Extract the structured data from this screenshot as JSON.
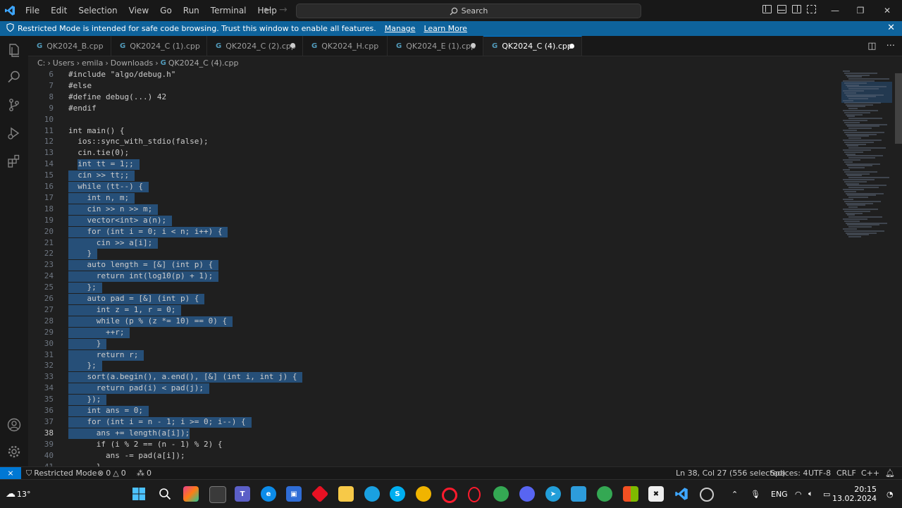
{
  "titlebar": {
    "menu": [
      "File",
      "Edit",
      "Selection",
      "View",
      "Go",
      "Run",
      "Terminal",
      "Help"
    ],
    "search_placeholder": "Search"
  },
  "banner": {
    "text": "Restricted Mode is intended for safe code browsing. Trust this window to enable all features.",
    "manage": "Manage",
    "learn_more": "Learn More"
  },
  "tabs": [
    {
      "label": "QK2024_B.cpp",
      "dirty": false
    },
    {
      "label": "QK2024_C (1).cpp",
      "dirty": false
    },
    {
      "label": "QK2024_C (2).cpp",
      "dirty": true
    },
    {
      "label": "QK2024_H.cpp",
      "dirty": false
    },
    {
      "label": "QK2024_E (1).cpp",
      "dirty": true
    },
    {
      "label": "QK2024_C (4).cpp",
      "dirty": true,
      "active": true
    }
  ],
  "breadcrumb": [
    "C:",
    "Users",
    "emila",
    "Downloads",
    "QK2024_C (4).cpp"
  ],
  "editor": {
    "current_line": 38,
    "lines": [
      {
        "n": 6,
        "text": "#include \"algo/debug.h\""
      },
      {
        "n": 7,
        "text": "#else"
      },
      {
        "n": 8,
        "text": "#define debug(...) 42"
      },
      {
        "n": 9,
        "text": "#endif"
      },
      {
        "n": 10,
        "text": ""
      },
      {
        "n": 11,
        "text": "int main() {"
      },
      {
        "n": 12,
        "text": "  ios::sync_with_stdio(false);"
      },
      {
        "n": 13,
        "text": "  cin.tie(0);"
      },
      {
        "n": 14,
        "text": "  int tt = 1;;"
      },
      {
        "n": 15,
        "text": "  cin >> tt;;"
      },
      {
        "n": 16,
        "text": "  while (tt--) {"
      },
      {
        "n": 17,
        "text": "    int n, m;"
      },
      {
        "n": 18,
        "text": "    cin >> n >> m;"
      },
      {
        "n": 19,
        "text": "    vector<int> a(n);"
      },
      {
        "n": 20,
        "text": "    for (int i = 0; i < n; i++) {"
      },
      {
        "n": 21,
        "text": "      cin >> a[i];"
      },
      {
        "n": 22,
        "text": "    }"
      },
      {
        "n": 23,
        "text": "    auto length = [&] (int p) {"
      },
      {
        "n": 24,
        "text": "      return int(log10(p) + 1);"
      },
      {
        "n": 25,
        "text": "    };"
      },
      {
        "n": 26,
        "text": "    auto pad = [&] (int p) {"
      },
      {
        "n": 27,
        "text": "      int z = 1, r = 0;"
      },
      {
        "n": 28,
        "text": "      while (p % (z *= 10) == 0) {"
      },
      {
        "n": 29,
        "text": "        ++r;"
      },
      {
        "n": 30,
        "text": "      }"
      },
      {
        "n": 31,
        "text": "      return r;"
      },
      {
        "n": 32,
        "text": "    };"
      },
      {
        "n": 33,
        "text": "    sort(a.begin(), a.end(), [&] (int i, int j) {"
      },
      {
        "n": 34,
        "text": "      return pad(i) < pad(j);"
      },
      {
        "n": 35,
        "text": "    });"
      },
      {
        "n": 36,
        "text": "    int ans = 0;"
      },
      {
        "n": 37,
        "text": "    for (int i = n - 1; i >= 0; i--) {"
      },
      {
        "n": 38,
        "text": "      ans += length(a[i]);"
      },
      {
        "n": 39,
        "text": "      if (i % 2 == (n - 1) % 2) {"
      },
      {
        "n": 40,
        "text": "        ans -= pad(a[i]);"
      },
      {
        "n": 41,
        "text": "      }"
      }
    ]
  },
  "statusbar": {
    "restricted": "Restricted Mode",
    "errors": "0",
    "warnings": "0",
    "ports": "0",
    "position": "Ln 38, Col 27 (556 selected)",
    "spaces": "Spaces: 4",
    "encoding": "UTF-8",
    "eol": "CRLF",
    "language": "C++"
  },
  "taskbar": {
    "weather": "13°",
    "lang": "ENG",
    "time": "20:15",
    "date": "13.02.2024"
  },
  "colors": {
    "accent": "#0078d4",
    "selection": "#264f78",
    "banner": "#0e639c"
  }
}
